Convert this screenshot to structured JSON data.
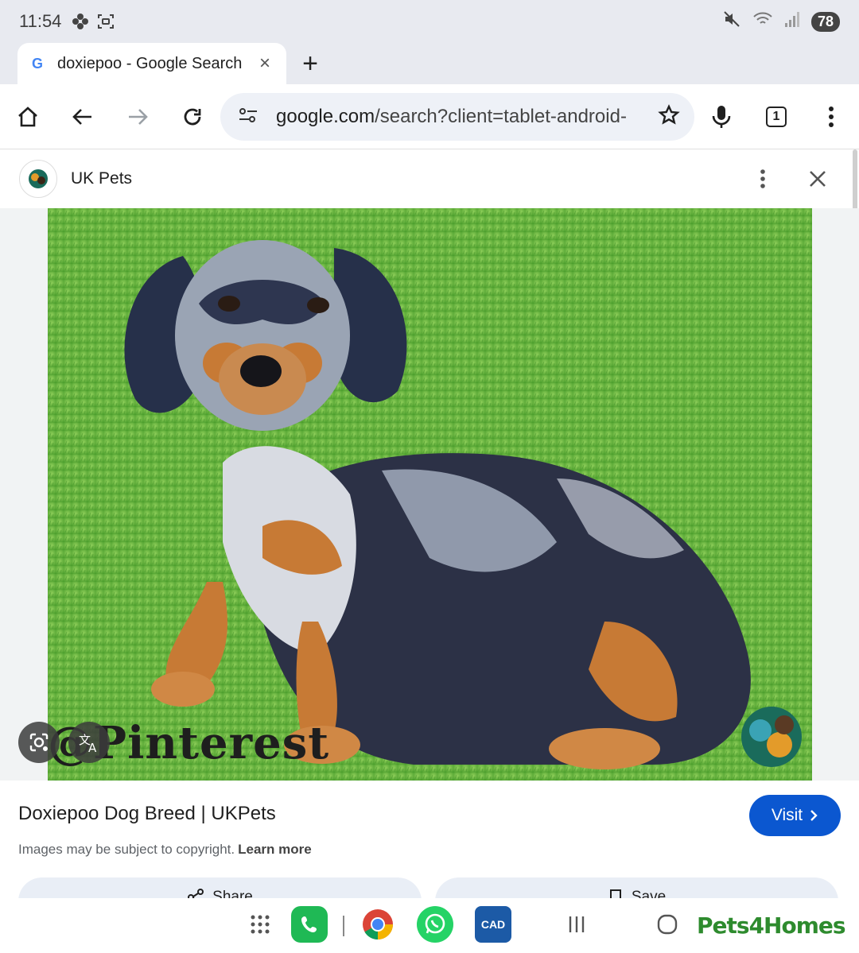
{
  "status_bar": {
    "time": "11:54",
    "battery": "78"
  },
  "tab": {
    "favicon": "G",
    "title": "doxiepoo - Google Search",
    "close": "×",
    "new_tab": "+"
  },
  "toolbar": {
    "url_host": "google.com",
    "url_path": "/search?client=tablet-android-",
    "tab_count": "1"
  },
  "panel": {
    "site_name": "UK Pets",
    "watermark": "@Pinterest",
    "result_title": "Doxiepoo Dog Breed | UKPets",
    "visit_label": "Visit",
    "copyright_text": "Images may be subject to copyright.",
    "learn_more": "Learn more",
    "share_label": "Share",
    "save_label": "Save"
  },
  "dock": {
    "cad_label": "CAD",
    "pets4homes_label": "Pets4Homes"
  },
  "colors": {
    "accent": "#0b57d0",
    "chrome_bg": "#e8eaf0",
    "omnibox_bg": "#eef1f7"
  }
}
